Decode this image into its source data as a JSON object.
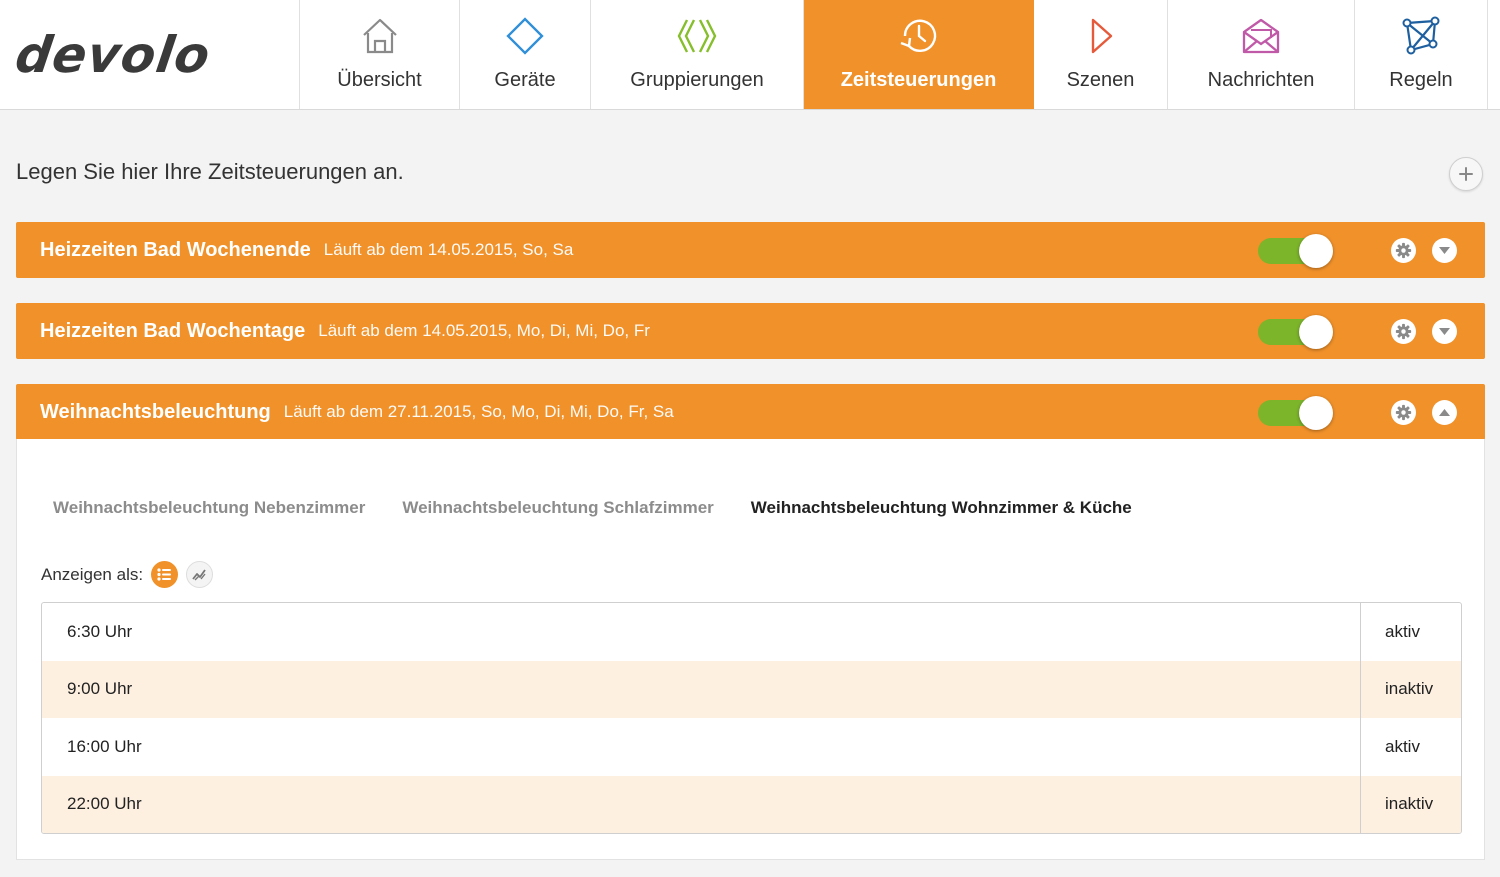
{
  "brand": {
    "logo_text": "devolo"
  },
  "nav": [
    {
      "id": "uebersicht",
      "label": "Übersicht",
      "icon": "house-icon",
      "active": false
    },
    {
      "id": "geraete",
      "label": "Geräte",
      "icon": "diamond-icon",
      "active": false
    },
    {
      "id": "gruppierungen",
      "label": "Gruppierungen",
      "icon": "group-chevrons-icon",
      "active": false
    },
    {
      "id": "zeitsteuerungen",
      "label": "Zeitsteuerungen",
      "icon": "clock-icon",
      "active": true
    },
    {
      "id": "szenen",
      "label": "Szenen",
      "icon": "play-icon",
      "active": false
    },
    {
      "id": "nachrichten",
      "label": "Nachrichten",
      "icon": "envelope-icon",
      "active": false
    },
    {
      "id": "regeln",
      "label": "Regeln",
      "icon": "network-icon",
      "active": false
    }
  ],
  "colors": {
    "accent": "#f0912a",
    "toggle_on": "#7cb42a",
    "row_alt": "#fdf0e1"
  },
  "page": {
    "intro": "Legen Sie hier Ihre Zeitsteuerungen an."
  },
  "schedules": [
    {
      "title": "Heizzeiten Bad Wochenende",
      "meta": "Läuft ab dem 14.05.2015, So, Sa",
      "enabled": true,
      "expanded": false
    },
    {
      "title": "Heizzeiten Bad Wochentage",
      "meta": "Läuft ab dem 14.05.2015, Mo, Di, Mi, Do, Fr",
      "enabled": true,
      "expanded": false
    },
    {
      "title": "Weihnachtsbeleuchtung",
      "meta": "Läuft ab dem 27.11.2015, So, Mo, Di, Mi, Do, Fr, Sa",
      "enabled": true,
      "expanded": true
    }
  ],
  "detail": {
    "tabs": [
      {
        "label": "Weihnachtsbeleuchtung Nebenzimmer",
        "active": false
      },
      {
        "label": "Weihnachtsbeleuchtung Schlafzimmer",
        "active": false
      },
      {
        "label": "Weihnachtsbeleuchtung Wohnzimmer & Küche",
        "active": true
      }
    ],
    "view_label": "Anzeigen als:",
    "entries": [
      {
        "time": "6:30 Uhr",
        "state": "aktiv"
      },
      {
        "time": "9:00 Uhr",
        "state": "inaktiv"
      },
      {
        "time": "16:00 Uhr",
        "state": "aktiv"
      },
      {
        "time": "22:00 Uhr",
        "state": "inaktiv"
      }
    ]
  }
}
